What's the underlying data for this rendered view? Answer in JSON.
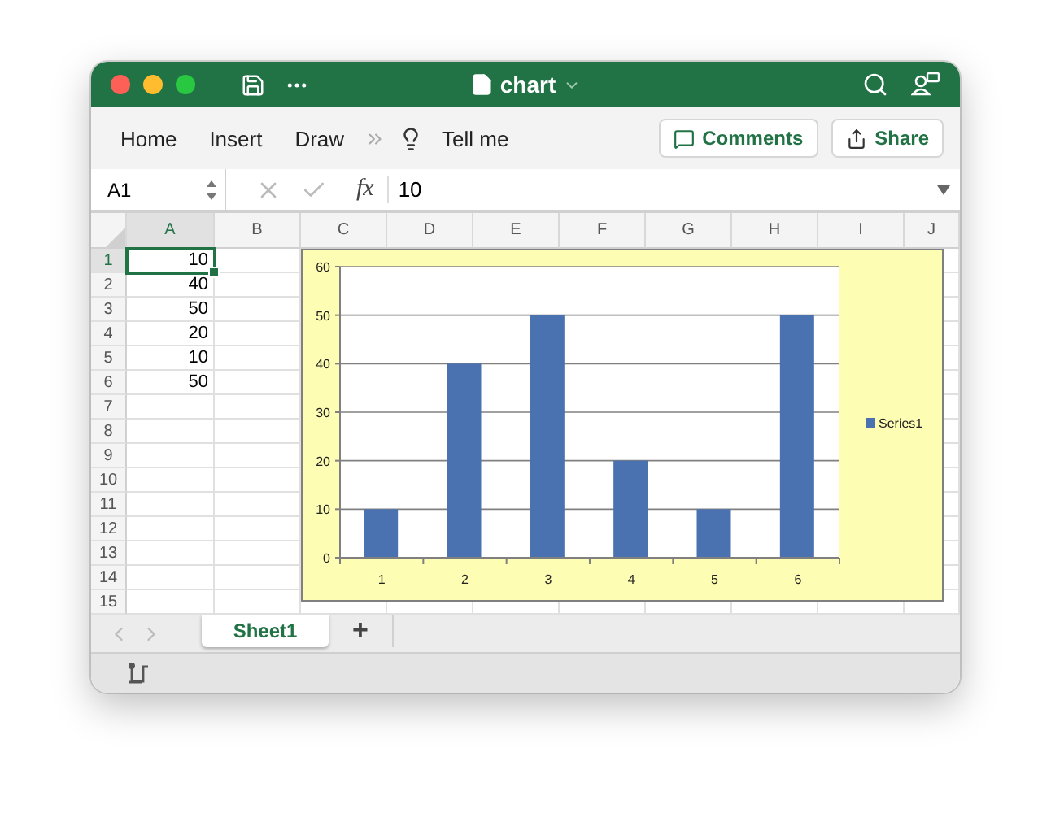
{
  "window": {
    "title": "chart"
  },
  "ribbon": {
    "tabs": [
      {
        "label": "Home"
      },
      {
        "label": "Insert"
      },
      {
        "label": "Draw"
      }
    ],
    "tell_me": "Tell me",
    "buttons": [
      {
        "kind": "comments",
        "label": "Comments"
      },
      {
        "kind": "share",
        "label": "Share"
      }
    ]
  },
  "formula_bar": {
    "name_box": "A1",
    "function_label": "fx",
    "formula": "10"
  },
  "sheet": {
    "columns": [
      "A",
      "B",
      "C",
      "D",
      "E",
      "F",
      "G",
      "H",
      "I",
      "J"
    ],
    "rows": [
      "1",
      "2",
      "3",
      "4",
      "5",
      "6",
      "7",
      "8",
      "9",
      "10",
      "11",
      "12",
      "13",
      "14",
      "15"
    ],
    "column_a": [
      {
        "value": "10",
        "selected": true
      },
      {
        "value": "40",
        "selected": false
      },
      {
        "value": "50",
        "selected": false
      },
      {
        "value": "20",
        "selected": false
      },
      {
        "value": "10",
        "selected": false
      },
      {
        "value": "50",
        "selected": false
      }
    ]
  },
  "chart": {
    "chart_data": {
      "type": "bar",
      "categories": [
        "1",
        "2",
        "3",
        "4",
        "5",
        "6"
      ],
      "series": [
        {
          "name": "Series1",
          "color": "#4a72b0",
          "values": [
            10,
            40,
            50,
            20,
            10,
            50
          ]
        }
      ],
      "ylim": [
        0,
        60
      ],
      "yticks": [
        0,
        10,
        20,
        30,
        40,
        50,
        60
      ],
      "grid": true
    }
  },
  "sheet_tabs": [
    {
      "label": "Sheet1",
      "selected": true
    }
  ],
  "add_sheet": "+"
}
